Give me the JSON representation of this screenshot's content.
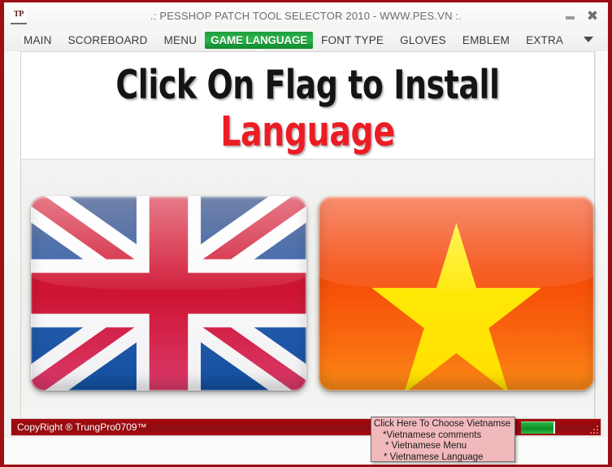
{
  "window": {
    "title": ".: PESSHOP PATCH TOOL SELECTOR 2010 - WWW.PES.VN :.",
    "logo_text": "TP",
    "minimize_icon": "minimize-icon",
    "close_icon": "close-icon",
    "frame_color": "#9c0f13"
  },
  "tabs": [
    {
      "label": "MAIN",
      "active": false
    },
    {
      "label": "SCOREBOARD",
      "active": false
    },
    {
      "label": "MENU",
      "active": false
    },
    {
      "label": "GAME LANGUAGE",
      "active": true
    },
    {
      "label": "FONT TYPE",
      "active": false
    },
    {
      "label": "GLOVES",
      "active": false
    },
    {
      "label": "EMBLEM",
      "active": false
    },
    {
      "label": "EXTRA",
      "active": false
    }
  ],
  "tab_overflow_icon": "chevron-down-icon",
  "active_tab_color": "#28b84a",
  "header": {
    "line1": "Click On Flag to Install",
    "line2": "Language",
    "line1_color": "#141414",
    "line2_color": "#ec1c24"
  },
  "flags": [
    {
      "name": "United Kingdom",
      "icon": "uk-flag-icon"
    },
    {
      "name": "Vietnam",
      "icon": "vietnam-flag-icon"
    }
  ],
  "tooltip": {
    "line1": "Click Here To Choose Vietnamse",
    "line2": "*Vietnamese comments",
    "line3": "* Vietnamese Menu",
    "line4": "* Vietnamese Language",
    "background": "#f2b9bd"
  },
  "statusbar": {
    "copyright": "CopyRight ® TrungPro0709™",
    "background": "#9a0a0f",
    "progress_color": "#1ea83a",
    "resize_grip_icon": "resize-grip-icon"
  }
}
